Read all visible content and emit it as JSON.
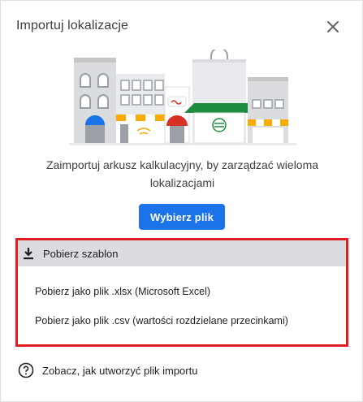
{
  "dialog": {
    "title": "Importuj lokalizacje",
    "close_icon": "close-icon"
  },
  "intro_text": "Zaimportuj arkusz kalkulacyjny, by zarządzać wieloma lokalizacjami",
  "choose_file_button": "Wybierz plik",
  "template_section": {
    "header_icon": "download-icon",
    "header_label": "Pobierz szablon",
    "options": [
      "Pobierz jako plik .xlsx (Microsoft Excel)",
      "Pobierz jako plik .csv (wartości rozdzielane przecinkami)"
    ]
  },
  "help_link": {
    "icon": "help-circle-icon",
    "label": "Zobacz, jak utworzyć plik importu"
  },
  "colors": {
    "primary": "#1a73e8",
    "highlight_border": "#e11d21",
    "header_bg": "#dadce0",
    "awning_green": "#1e8e3e",
    "awning_red": "#d93025",
    "awning_yellow": "#f9ab00"
  }
}
